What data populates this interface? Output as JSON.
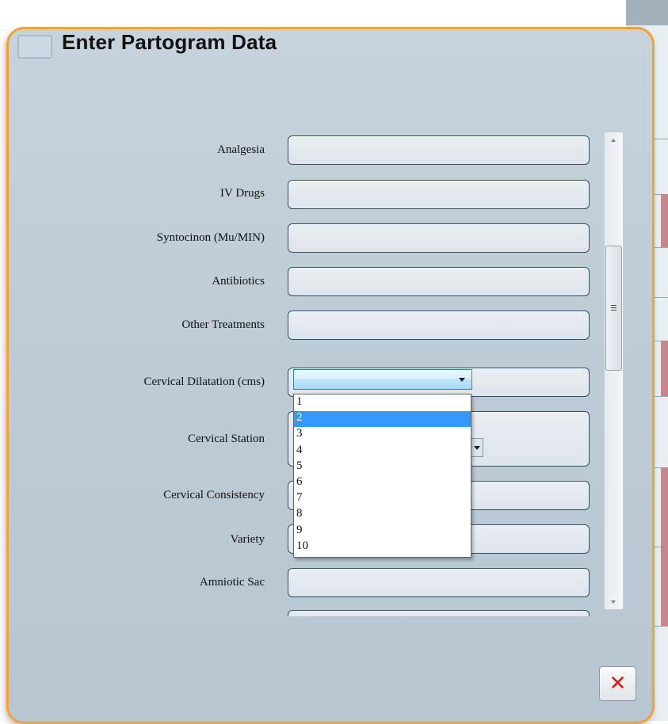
{
  "dialog": {
    "title": "Enter Partogram Data",
    "close_icon": "close-icon",
    "title_icon": "window-icon"
  },
  "form": {
    "fields": [
      {
        "label": "Analgesia",
        "value": ""
      },
      {
        "label": "IV Drugs",
        "value": ""
      },
      {
        "label": "Syntocinon (Mu/MIN)",
        "value": ""
      },
      {
        "label": "Antibiotics",
        "value": ""
      },
      {
        "label": "Other Treatments",
        "value": ""
      },
      {
        "label": "Cervical Dilatation (cms)",
        "value": ""
      },
      {
        "label": "Cervical Station",
        "value": ""
      },
      {
        "label": "Cervical Consistency",
        "value": ""
      },
      {
        "label": "Variety",
        "value": ""
      },
      {
        "label": "Amniotic Sac",
        "value": ""
      }
    ]
  },
  "cervical_dilatation_dropdown": {
    "options": [
      "1",
      "2",
      "3",
      "4",
      "5",
      "6",
      "7",
      "8",
      "9",
      "10"
    ],
    "highlighted": "2"
  },
  "scrollbar": {
    "grip_icon": "grip-icon"
  },
  "colors": {
    "accent_border": "#f3a131",
    "selection": "#3399ff",
    "close_x": "#e01818"
  }
}
